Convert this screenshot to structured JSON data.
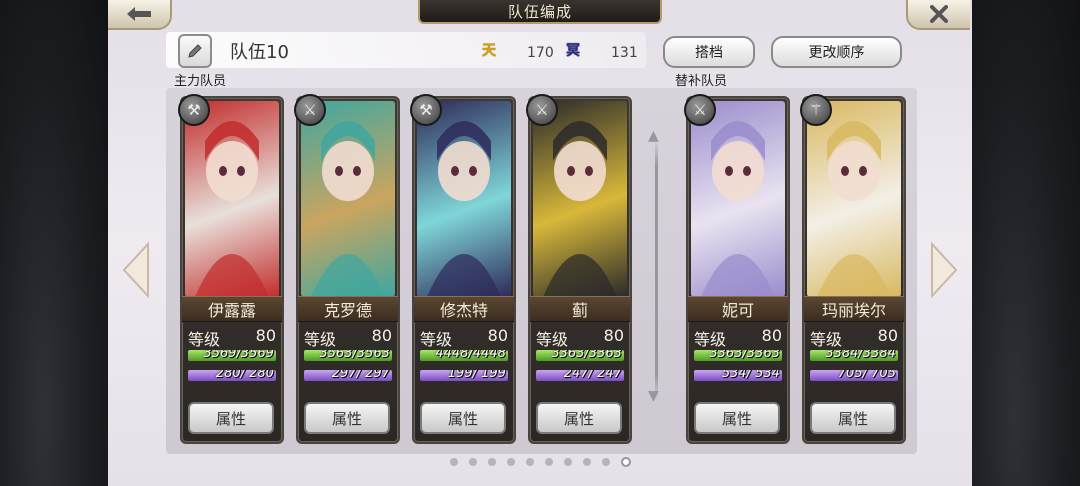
{
  "header": {
    "title": "队伍编成",
    "back_icon": "back-arrow-icon",
    "close_icon": "close-icon"
  },
  "team": {
    "name": "队伍10",
    "heaven_icon_text": "天",
    "heaven_value": "170",
    "hell_icon_text": "冥",
    "hell_value": "131"
  },
  "buttons": {
    "partner": "搭档",
    "change_order": "更改顺序"
  },
  "sections": {
    "main": "主力队员",
    "sub": "替补队员"
  },
  "level_label": "等级",
  "attr_label": "属性",
  "members": [
    {
      "name": "伊露露",
      "level": "80",
      "hp": "3569/3569",
      "sp": "280/ 280",
      "weapon": "axe-icon",
      "colors": [
        "#c22c2c",
        "#e8e0da"
      ]
    },
    {
      "name": "克罗德",
      "level": "80",
      "hp": "3563/3563",
      "sp": "297/ 297",
      "weapon": "sword-icon",
      "colors": [
        "#3fa6a0",
        "#caa560"
      ]
    },
    {
      "name": "修杰特",
      "level": "80",
      "hp": "4448/4448",
      "sp": "199/ 199",
      "weapon": "axe-icon",
      "colors": [
        "#2e2a5a",
        "#7fd6d8"
      ]
    },
    {
      "name": "蓟",
      "level": "80",
      "hp": "3363/3363",
      "sp": "247/ 247",
      "weapon": "sword-icon",
      "colors": [
        "#2a2a2a",
        "#d8b83a"
      ]
    },
    {
      "name": "妮可",
      "level": "80",
      "hp": "3363/3363",
      "sp": "534/ 534",
      "weapon": "sword-icon",
      "colors": [
        "#9a8ccc",
        "#e9e3f0"
      ]
    },
    {
      "name": "玛丽埃尔",
      "level": "80",
      "hp": "3384/3384",
      "sp": "705/ 705",
      "weapon": "staff-icon",
      "colors": [
        "#d8b860",
        "#f3efe6"
      ]
    }
  ],
  "pager": {
    "total": 10,
    "active": 10
  },
  "colors": {
    "accent_gold": "#b09c6a",
    "hp_green": "#4f9a24",
    "sp_purple": "#7c4cc4"
  }
}
